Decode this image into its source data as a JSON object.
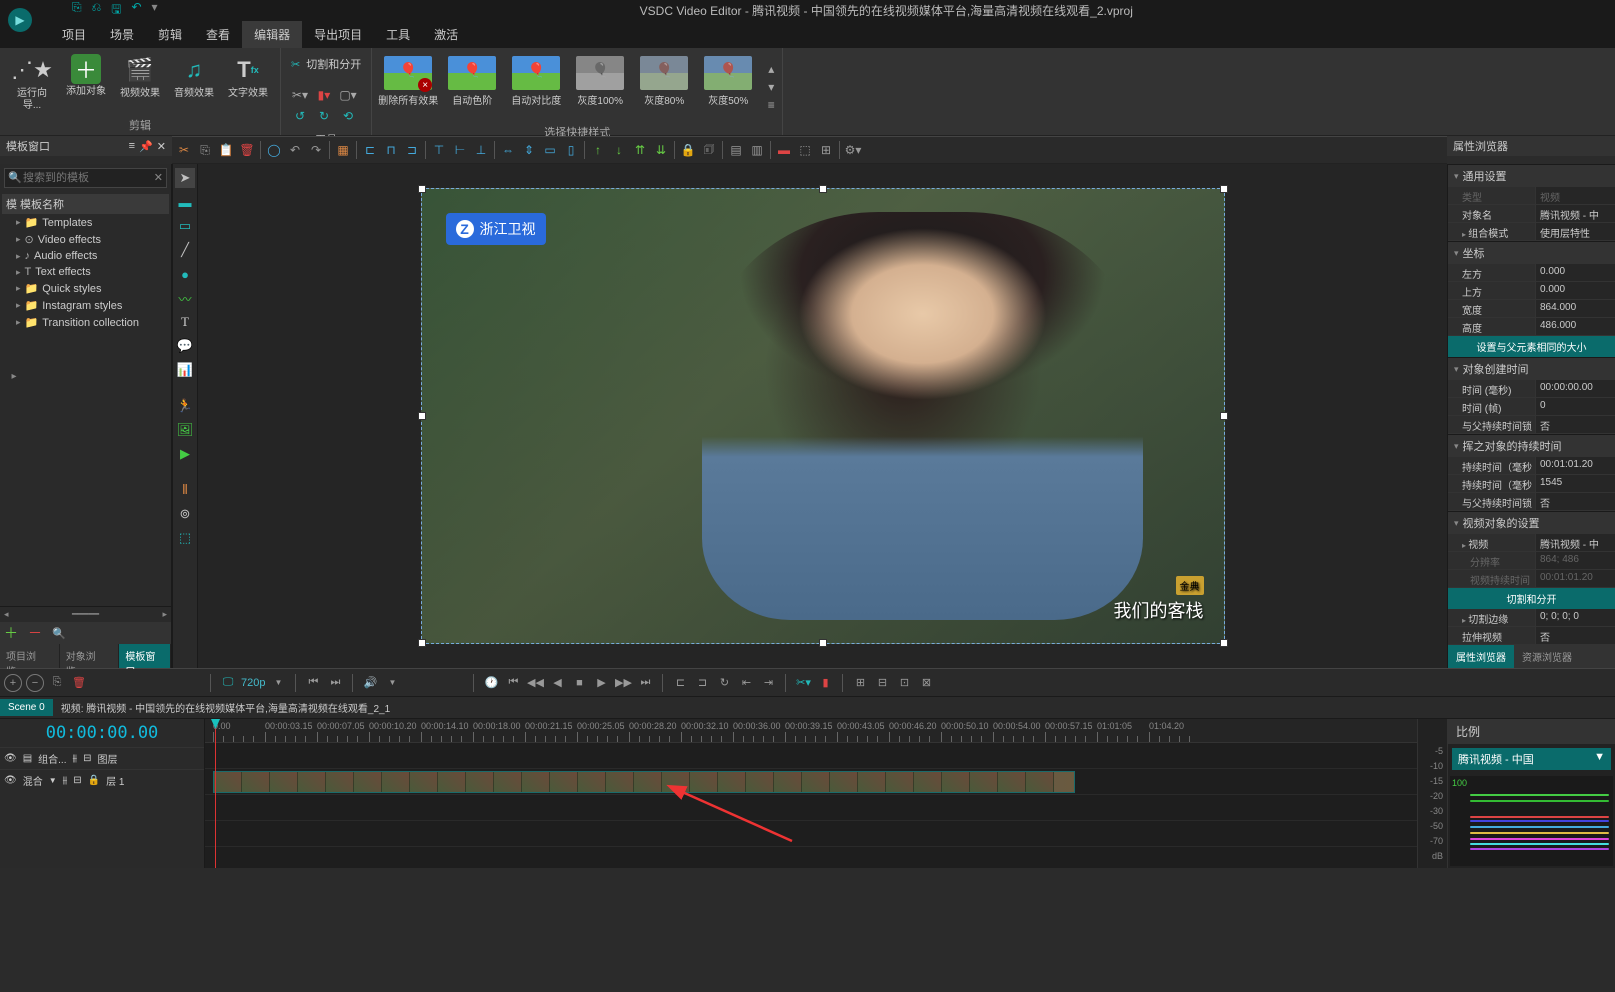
{
  "window": {
    "title": "VSDC Video Editor - 腾讯视频 - 中国领先的在线视频媒体平台,海量高清视频在线观看_2.vproj"
  },
  "menu": {
    "items": [
      "项目",
      "场景",
      "剪辑",
      "查看",
      "编辑器",
      "导出项目",
      "工具",
      "激活"
    ],
    "activeIndex": 4
  },
  "ribbon": {
    "groups": {
      "edit": {
        "title": "剪辑",
        "buttons": [
          {
            "label": "运行向导...",
            "icon": "✨"
          },
          {
            "label": "添加对象",
            "icon": "＋",
            "bg": "#3a8a3a"
          },
          {
            "label": "视频效果",
            "icon": "🎬"
          },
          {
            "label": "音频效果",
            "icon": "♪",
            "teal": true
          },
          {
            "label": "文字效果",
            "icon": "T"
          }
        ]
      },
      "tools": {
        "title": "工具",
        "cutsplit": "切割和分开"
      },
      "quickstyles": {
        "title": "选择快捷样式",
        "items": [
          {
            "label": "删除所有效果",
            "fx": true
          },
          {
            "label": "自动色阶"
          },
          {
            "label": "自动对比度"
          },
          {
            "label": "灰度100%",
            "gray": true
          },
          {
            "label": "灰度80%",
            "gray": true
          },
          {
            "label": "灰度50%",
            "gray": true
          }
        ]
      }
    }
  },
  "templatesPanel": {
    "title": "模板窗口",
    "searchPlaceholder": "搜索到的模板",
    "columnHeader": "模 模板名称",
    "items": [
      {
        "label": "Templates",
        "icon": "📁"
      },
      {
        "label": "Video effects",
        "icon": "⊙"
      },
      {
        "label": "Audio effects",
        "icon": "♪"
      },
      {
        "label": "Text effects",
        "icon": "T"
      },
      {
        "label": "Quick styles",
        "icon": "📁"
      },
      {
        "label": "Instagram styles",
        "icon": "📁"
      },
      {
        "label": "Transition collection",
        "icon": "📁"
      }
    ],
    "tabs": [
      "项目浏览...",
      "对象浏览...",
      "模板窗口"
    ],
    "activeTab": 2
  },
  "preview": {
    "watermark_tl": "浙江卫视",
    "watermark_br_tag": "金典",
    "watermark_br_text": "我们的客栈"
  },
  "properties": {
    "title": "属性浏览器",
    "sections": {
      "general": {
        "title": "通用设置",
        "rows": [
          {
            "k": "类型",
            "v": "视频",
            "dim": true
          },
          {
            "k": "对象名",
            "v": "腾讯视频 - 中"
          },
          {
            "k": "组合模式",
            "v": "使用层特性",
            "arr": true
          }
        ]
      },
      "coords": {
        "title": "坐标",
        "rows": [
          {
            "k": "左方",
            "v": "0.000"
          },
          {
            "k": "上方",
            "v": "0.000"
          },
          {
            "k": "宽度",
            "v": "864.000"
          },
          {
            "k": "高度",
            "v": "486.000"
          }
        ],
        "action": "设置与父元素相同的大小"
      },
      "createtime": {
        "title": "对象创建时间",
        "rows": [
          {
            "k": "时间 (毫秒)",
            "v": "00:00:00.00"
          },
          {
            "k": "时间 (帧)",
            "v": "0"
          },
          {
            "k": "与父持续时间锁",
            "v": "否"
          }
        ]
      },
      "duration": {
        "title": "挥之对象的持续时间",
        "rows": [
          {
            "k": "持续时间（毫秒",
            "v": "00:01:01.20"
          },
          {
            "k": "持续时间（毫秒",
            "v": "1545"
          },
          {
            "k": "与父持续时间锁",
            "v": "否"
          }
        ]
      },
      "videoobj": {
        "title": "视频对象的设置",
        "rows": [
          {
            "k": "视频",
            "v": "腾讯视频 - 中",
            "arr": true
          },
          {
            "k": "分辨率",
            "v": "864; 486",
            "dim": true
          },
          {
            "k": "视频持续时间",
            "v": "00:01:01.20",
            "dim": true
          }
        ],
        "action": "切割和分开",
        "rows2": [
          {
            "k": "切割边缘",
            "v": "0; 0; 0; 0",
            "arr": true
          },
          {
            "k": "拉伸视频",
            "v": "否"
          }
        ]
      }
    },
    "tabs": [
      "属性浏览器",
      "资源浏览器"
    ],
    "activeTab": 0
  },
  "scalePanel": {
    "title": "比例",
    "dropdown": "腾讯视频 - 中国",
    "axisTop": "100"
  },
  "timeline": {
    "resolution": "720p",
    "sceneTab": "Scene 0",
    "scenePath": "视频: 腾讯视频 - 中国领先的在线视频媒体平台,海量高清视频在线观看_2_1",
    "time": "00:00:00.00",
    "trackHdr1": {
      "combo": "组合...",
      "layer": "图层"
    },
    "trackHdr2": {
      "blend": "混合",
      "layer": "层 1"
    },
    "rulerMarks": [
      "0.00",
      "00:00:03.15",
      "00:00:07.05",
      "00:00:10.20",
      "00:00:14.10",
      "00:00:18.00",
      "00:00:21.15",
      "00:00:25.05",
      "00:00:28.20",
      "00:00:32.10",
      "00:00:36.00",
      "00:00:39.15",
      "00:00:43.05",
      "00:00:46.20",
      "00:00:50.10",
      "00:00:54.00",
      "00:00:57.15",
      "01:01:05",
      "01:04.20"
    ],
    "dbScale": [
      "-5",
      "-10",
      "-15",
      "-20",
      "-30",
      "-50",
      "-70",
      "dB"
    ]
  }
}
